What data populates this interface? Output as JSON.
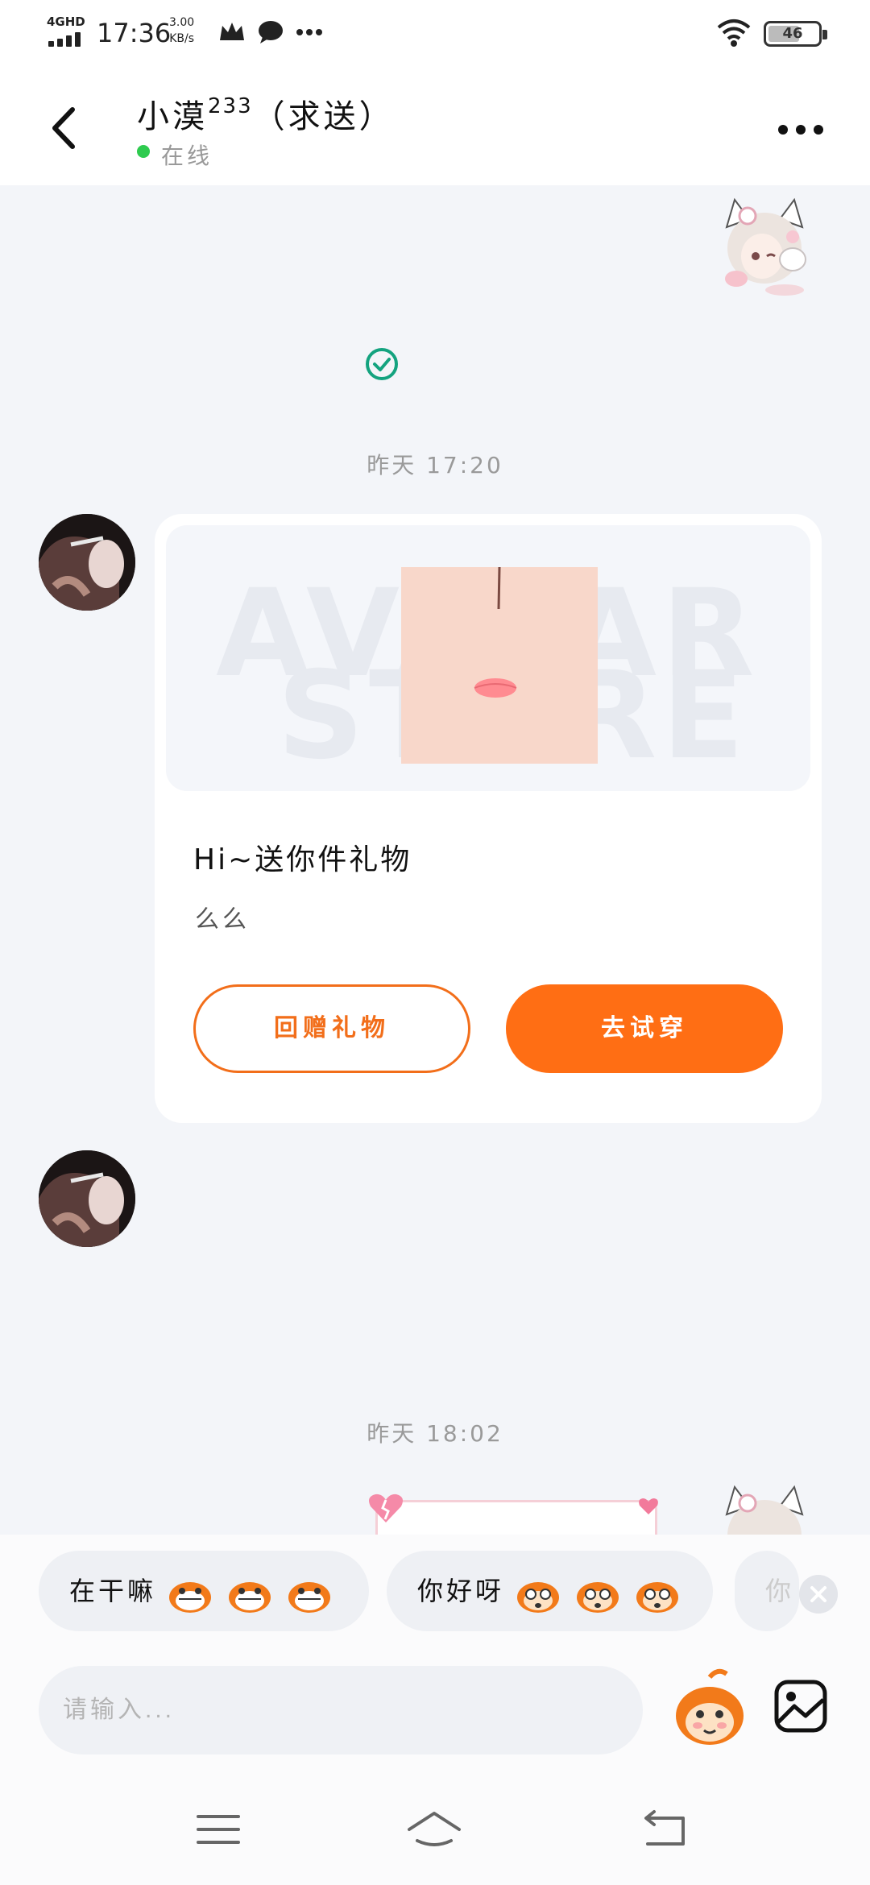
{
  "status_bar": {
    "network": "4GHD",
    "time": "17:36",
    "speed_value": "3.00",
    "speed_unit": "KB/s",
    "battery": "46"
  },
  "header": {
    "name": "小漠",
    "name_sup": "233",
    "name_suffix": "（求送）",
    "status": "在线"
  },
  "chat": {
    "timestamp_1": "昨天  17:20",
    "timestamp_2": "昨天  18:02",
    "gift_card": {
      "title": "Hi~送你件礼物",
      "message": "么么",
      "return_button": "回赠礼物",
      "try_button": "去试穿",
      "watermark_line1": "AVATAR",
      "watermark_line2": "STORE"
    }
  },
  "quick_replies": [
    {
      "text": "在干嘛"
    },
    {
      "text": "你好呀"
    },
    {
      "text": "你"
    }
  ],
  "input": {
    "placeholder": "请输入..."
  },
  "colors": {
    "accent": "#ff6e14",
    "online": "#2ecb4f",
    "sent_check": "#13a37f",
    "background": "#f3f5f9"
  }
}
